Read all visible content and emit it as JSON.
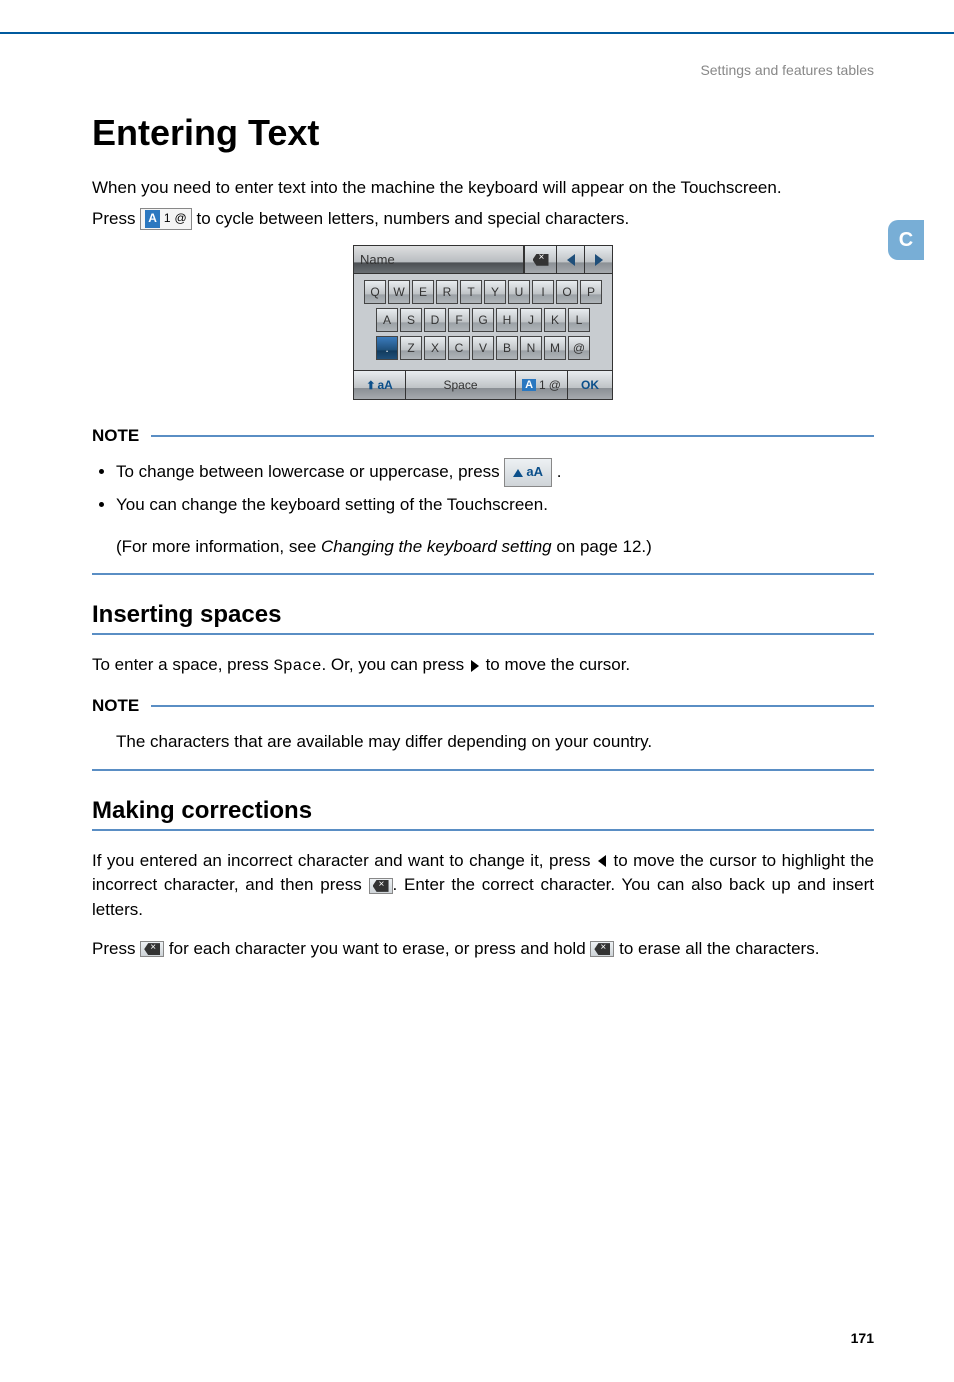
{
  "breadcrumb": "Settings and features tables",
  "side_tab": "C",
  "title": "Entering Text",
  "intro_line1": "When you need to enter text into the machine the keyboard will appear on the Touchscreen.",
  "intro_line2_pre": "Press ",
  "intro_line2_post": " to cycle between letters, numbers and special characters.",
  "mode_key": {
    "a": "A",
    "one": "1",
    "at": "@"
  },
  "keyboard": {
    "title": "Name",
    "row1": [
      "Q",
      "W",
      "E",
      "R",
      "T",
      "Y",
      "U",
      "I",
      "O",
      "P"
    ],
    "row2": [
      "A",
      "S",
      "D",
      "F",
      "G",
      "H",
      "J",
      "K",
      "L"
    ],
    "row3": [
      ".",
      "Z",
      "X",
      "C",
      "V",
      "B",
      "N",
      "M",
      "@"
    ],
    "shift": "aA",
    "space": "Space",
    "mode": {
      "a": "A",
      "one": "1",
      "at": "@"
    },
    "ok": "OK"
  },
  "note1": {
    "label": "NOTE",
    "bullet1_pre": "To change between lowercase or uppercase, press ",
    "bullet1_key": "aA",
    "bullet1_post": ".",
    "bullet2": "You can change the keyboard setting of the Touchscreen.",
    "bullet2_sub_pre": "(For more information, see ",
    "bullet2_sub_link": "Changing the keyboard setting",
    "bullet2_sub_post": " on page 12.)"
  },
  "sect1": {
    "heading": "Inserting spaces",
    "text_pre": "To enter a space, press ",
    "space_key": "Space",
    "text_mid": ". Or, you can press ",
    "text_post": " to move the cursor."
  },
  "note2": {
    "label": "NOTE",
    "text": "The characters that are available may differ depending on your country."
  },
  "sect2": {
    "heading": "Making corrections",
    "para1_a": "If you entered an incorrect character and want to change it, press ",
    "para1_b": " to move the cursor to highlight the incorrect character, and then press ",
    "para1_c": ". Enter the correct character. You can also back up and insert letters.",
    "para2_a": "Press ",
    "para2_b": " for each character you want to erase, or press and hold ",
    "para2_c": " to erase all the characters."
  },
  "page_number": "171"
}
